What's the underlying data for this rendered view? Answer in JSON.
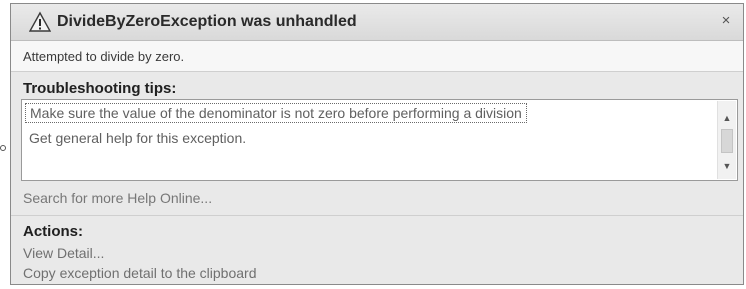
{
  "dialog": {
    "title": "DivideByZeroException was unhandled",
    "close_label": "×",
    "message": "Attempted to divide by zero."
  },
  "tips": {
    "title": "Troubleshooting tips:",
    "items": [
      "Make sure the value of the denominator is not zero before performing a division",
      "Get general help for this exception."
    ],
    "scroll_up": "▲",
    "scroll_down": "▼"
  },
  "help_link": "Search for more Help Online...",
  "actions": {
    "title": "Actions:",
    "items": [
      "View Detail...",
      "Copy exception detail to the clipboard"
    ]
  },
  "icons": {
    "warning": "warning-icon",
    "close": "close-icon"
  }
}
